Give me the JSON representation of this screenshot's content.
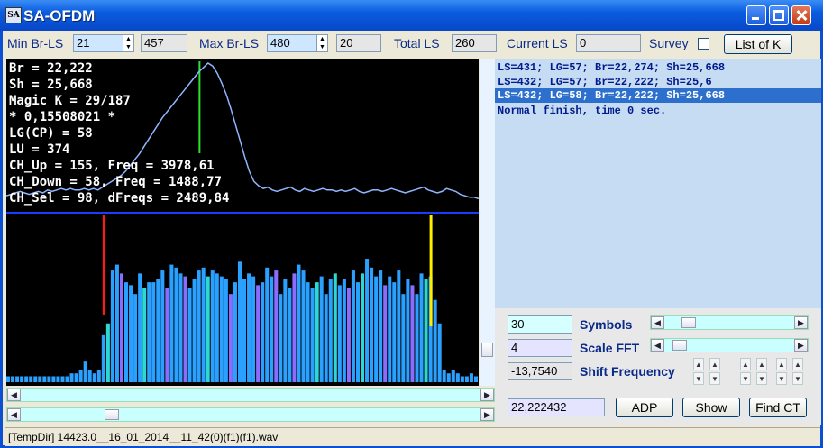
{
  "app": {
    "title": "SA-OFDM",
    "icon_text": "SA"
  },
  "toolbar": {
    "min_label": "Min Br-LS",
    "min_value": "21",
    "min_result": "457",
    "max_label": "Max Br-LS",
    "max_value": "480",
    "max_result": "20",
    "total_label": "Total LS",
    "total_value": "260",
    "current_label": "Current LS",
    "current_value": "0",
    "survey_label": "Survey",
    "listk_label": "List of K"
  },
  "info_lines": [
    "Br = 22,222",
    "Sh = 25,668",
    "Magic K = 29/187",
    "* 0,15508021 *",
    "LG(CP) = 58",
    "LU = 374",
    "CH_Up = 155, Freq = 3978,61",
    "CH_Down = 58, Freq = 1488,77",
    "CH_Sel = 98, dFreqs = 2489,84"
  ],
  "log_lines": [
    "LS=431; LG=57; Br=22,274; Sh=25,668",
    "LS=432; LG=57; Br=22,222; Sh=25,6",
    "LS=432; LG=58; Br=22,222; Sh=25,668",
    "Normal finish, time 0 sec."
  ],
  "controls": {
    "symbols_value": "30",
    "symbols_label": "Symbols",
    "scale_value": "4",
    "scale_label": "Scale FFT",
    "shift_value": "-13,7540",
    "shift_label": "Shift Frequency",
    "br_value": "22,222432",
    "adp_label": "ADP",
    "show_label": "Show",
    "findct_label": "Find CT"
  },
  "status": {
    "text": "[TempDir] 14423.0__16_01_2014__11_42(0)(f1)(f1).wav"
  },
  "colors": {
    "accent": "#0848c8",
    "bar": "#2aa0ff",
    "bar_alt": "#8c6cff",
    "bar_cyan": "#2cd8d0",
    "marker_red": "#ff1a1a",
    "marker_yellow": "#ffee00",
    "marker_green": "#2ee02e",
    "curve": "#8fb6ff"
  },
  "spectrum": {
    "bars": [
      2,
      2,
      2,
      2,
      2,
      2,
      2,
      2,
      2,
      2,
      2,
      2,
      2,
      2,
      3,
      3,
      4,
      7,
      4,
      3,
      4,
      16,
      20,
      38,
      40,
      37,
      34,
      33,
      30,
      37,
      32,
      34,
      34,
      35,
      38,
      32,
      40,
      39,
      37,
      36,
      32,
      35,
      38,
      39,
      36,
      38,
      37,
      36,
      35,
      30,
      34,
      41,
      35,
      37,
      36,
      33,
      34,
      39,
      36,
      38,
      30,
      35,
      32,
      37,
      40,
      38,
      34,
      32,
      34,
      36,
      30,
      35,
      37,
      33,
      35,
      32,
      38,
      34,
      37,
      42,
      39,
      36,
      38,
      33,
      36,
      34,
      38,
      30,
      35,
      33,
      30,
      37,
      35,
      36,
      28,
      20,
      4,
      3,
      4,
      3,
      2,
      2,
      3,
      2
    ],
    "accent_bars": [
      22,
      25,
      30,
      35,
      39,
      44,
      49,
      55,
      59,
      63,
      68,
      72,
      75,
      78,
      83,
      89,
      92
    ],
    "markers": {
      "red_index": 21,
      "yellow_index": 93,
      "green_index": 48
    },
    "curve": [
      0.08,
      0.09,
      0.1,
      0.11,
      0.1,
      0.09,
      0.1,
      0.11,
      0.1,
      0.12,
      0.11,
      0.12,
      0.13,
      0.12,
      0.13,
      0.12,
      0.12,
      0.13,
      0.12,
      0.13,
      0.12,
      0.14,
      0.16,
      0.18,
      0.2,
      0.22,
      0.25,
      0.29,
      0.33,
      0.37,
      0.42,
      0.47,
      0.52,
      0.57,
      0.62,
      0.66,
      0.7,
      0.74,
      0.78,
      0.82,
      0.86,
      0.9,
      0.94,
      0.97,
      1.0,
      0.98,
      0.93,
      0.86,
      0.78,
      0.68,
      0.57,
      0.46,
      0.35,
      0.25,
      0.18,
      0.15,
      0.13,
      0.14,
      0.12,
      0.11,
      0.12,
      0.13,
      0.14,
      0.12,
      0.11,
      0.13,
      0.12,
      0.11,
      0.12,
      0.13,
      0.12,
      0.12,
      0.11,
      0.12,
      0.11,
      0.12,
      0.13,
      0.11,
      0.1,
      0.11,
      0.12,
      0.12,
      0.11,
      0.12,
      0.13,
      0.12,
      0.11,
      0.1,
      0.11,
      0.12,
      0.13,
      0.14,
      0.12,
      0.11,
      0.1,
      0.11,
      0.13,
      0.12,
      0.11,
      0.09,
      0.08,
      0.07,
      0.07,
      0.06
    ]
  }
}
